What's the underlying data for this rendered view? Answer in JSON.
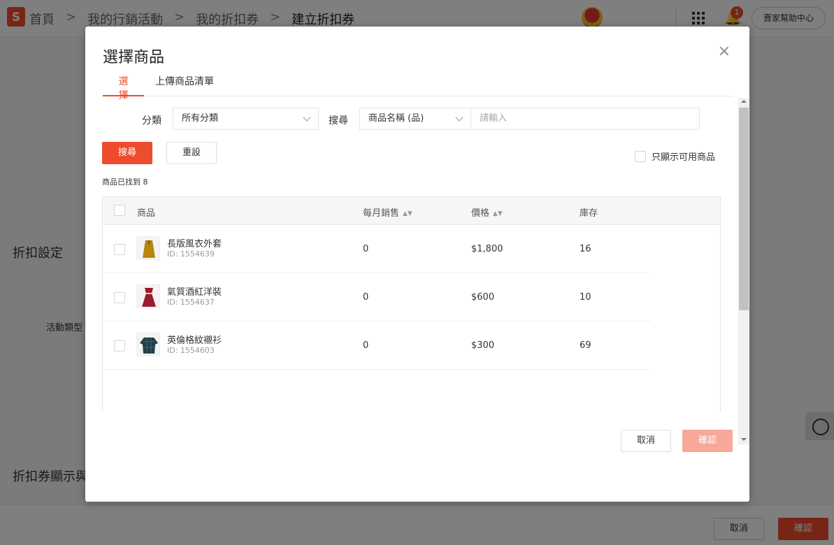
{
  "topbar": {
    "logo_letter": "S",
    "breadcrumbs": [
      "首頁",
      "我的行銷活動",
      "我的折扣券",
      "建立折扣券"
    ],
    "separator": ">",
    "notification_count": "1",
    "help_label": "賣家幫助中心"
  },
  "background": {
    "section_discount_settings": "折扣設定",
    "field_activity_type": "活動類型",
    "section_display": "折扣券顯示與",
    "cancel_label": "取消",
    "confirm_label": "確認"
  },
  "modal": {
    "title": "選擇商品",
    "close_icon": "×",
    "tabs": [
      {
        "label": "選擇"
      },
      {
        "label": "上傳商品清單"
      }
    ],
    "filters": {
      "category_label": "分類",
      "category_value": "所有分類",
      "search_label": "搜尋",
      "search_field_value": "商品名稱 (品)",
      "search_placeholder": "請輸入"
    },
    "search_button": "搜尋",
    "reset_button": "重設",
    "only_available_label": "只顯示可用商品",
    "found_text": "商品已找到 8",
    "table": {
      "headers": {
        "product": "商品",
        "monthly_sales": "每月銷售",
        "price": "價格",
        "stock": "庫存"
      },
      "sort_icon": "▲▼",
      "rows": [
        {
          "name": "長版風衣外套",
          "id": "ID: 1554639",
          "sales": "0",
          "price": "$1,800",
          "stock": "16",
          "thumb": "coat-image"
        },
        {
          "name": "氣質酒紅洋裝",
          "id": "ID: 1554637",
          "sales": "0",
          "price": "$600",
          "stock": "10",
          "thumb": "dress-image"
        },
        {
          "name": "英倫格紋襯衫",
          "id": "ID: 1554603",
          "sales": "0",
          "price": "$300",
          "stock": "69",
          "thumb": "shirt-image"
        }
      ]
    },
    "cancel_button": "取消",
    "confirm_button": "確認"
  },
  "colors": {
    "accent": "#ee4d2d",
    "accent_disabled": "#f7a899"
  }
}
